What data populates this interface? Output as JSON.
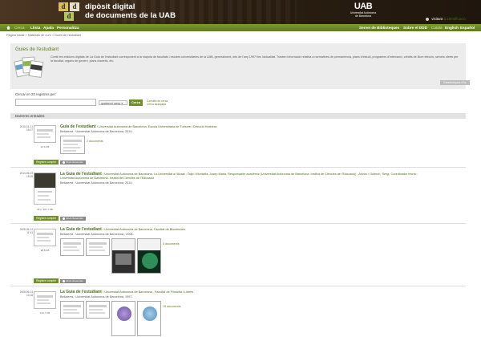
{
  "header": {
    "site_title_line1": "dipòsit digital",
    "site_title_line2": "de documents de la UAB",
    "logo_letters": [
      "d",
      "d",
      "d"
    ],
    "uab_logo": "UAB",
    "uab_sub_line1": "Universitat Autònoma",
    "uab_sub_line2": "de Barcelona",
    "user_label": "visitant",
    "login_label": "identificació"
  },
  "nav": {
    "items": [
      "Cerca",
      "Llista",
      "Ajuda",
      "Personalitza"
    ],
    "right_items": [
      "Servei de Biblioteques",
      "Sobre el DDD"
    ],
    "languages": [
      "Català",
      "English",
      "Español"
    ]
  },
  "breadcrumb": "Pàgina inicial > Materials de curs > Guies de l'estudiant",
  "collection": {
    "title": "Guies de l'estudiant",
    "description": "Conté les edicions digitals de La Guia de l'estudiant corresponent a la majoria de facultats i escoles universitàries de la UAB, generalment, des de l'any 1997 fins l'actualitat. Tracten informació relativa a normatives de permanència, plans d'estudi, programes d'intercanvi, crèdits de lliure elecció, serveis oferts per la facultat, organs de govern, plans docents, etc.",
    "stats_button": "Estadístiques d'ús"
  },
  "search": {
    "label": "Cercar en 20 registres per:",
    "input_value": "",
    "field_select": "qualsevol camp",
    "button": "Cerca",
    "link1": "Consells de cerca",
    "link2": "Cerca avançada"
  },
  "recent": {
    "header": "Darreres entrades:",
    "records": [
      {
        "date_line1": "2015-01-21",
        "date_line2": "16:07",
        "size": "12,6 KB",
        "title": "Guia de l'estudiant",
        "authors": "/ Universitat Autònoma de Barcelona. Escola Universitària de Turisme i Direcció Hotelera",
        "pub": "Bellaterra : Universitat Autònoma de Barcelona, 2014-",
        "docs": "2 documents",
        "full_btn": "Registre complet",
        "rights": "Drets Reservats"
      },
      {
        "date_line1": "2014-06-03",
        "date_line2": "18:18",
        "size": "36 p, 821.7 KB",
        "title": "La Guia de l'estudiant",
        "authors": "/ Universitat Autònoma de Barcelona. La Universitat a l'Abast ; Talpi i Montaña, Josep Maria, Responsable acadèmic (Universitat Autònoma de Barcelona. Institut de Ciències de l'Educació) ; Ariznó i Oulerch, Sergi, Coordinador tècnic ;",
        "authors2": "Universitat Autònoma de Barcelona. Institut de Ciències de l'Educació",
        "pub": "Bellaterra : Universitat Autònoma de Barcelona, 2014-",
        "full_btn": "Registre complet",
        "rights": "Drets Reservats"
      },
      {
        "date_line1": "2008-06-13",
        "date_line2": "11:41",
        "size": "98,8 KB",
        "title": "La Guia de l'estudiant",
        "authors": "/ Universitat Autònoma de Barcelona. Facultat de Biociències",
        "pub": "Bellaterra : Universitat Autònoma de Barcelona , 2008-",
        "docs": "5 documents",
        "full_btn": "Registre complet",
        "rights": "Drets Reservats"
      },
      {
        "date_line1": "2008-06-13",
        "date_line2": "10:18",
        "size": "133,7 KB",
        "title": "La Guia de l'estudiant",
        "authors": "/ Universitat Autònoma de Barcelona . Facultat de Filosofia i Lletres",
        "pub": "Bellaterra : Universitat Autònoma de Barcelona, 1997-",
        "docs": "15 documents"
      }
    ]
  },
  "colors": {
    "brand_green": "#6f8f2a",
    "header_brown": "#2d2013",
    "link_green": "#4a6a1e"
  }
}
